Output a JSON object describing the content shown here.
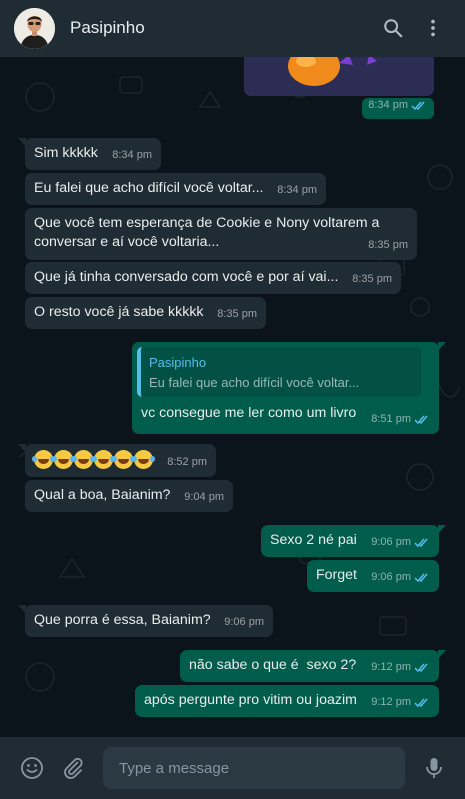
{
  "header": {
    "contact_name": "Pasipinho"
  },
  "messages": [
    {
      "direction": "out",
      "type": "sticker",
      "time": "8:34 pm",
      "status": "read"
    },
    {
      "direction": "in",
      "text": "Sim kkkkk",
      "time": "8:34 pm"
    },
    {
      "direction": "in",
      "text": "Eu falei que acho difícil você voltar...",
      "time": "8:34 pm"
    },
    {
      "direction": "in",
      "text": "Que você tem esperança de Cookie e Nony voltarem a conversar e aí você voltaria...",
      "time": "8:35 pm"
    },
    {
      "direction": "in",
      "text": "Que já tinha conversado com você e por aí vai...",
      "time": "8:35 pm"
    },
    {
      "direction": "in",
      "text": "O resto você já sabe kkkkk",
      "time": "8:35 pm"
    },
    {
      "direction": "out",
      "quote_author": "Pasipinho",
      "quote_text": "Eu falei que acho difícil você voltar...",
      "text": "vc consegue me ler como um livro",
      "time": "8:51 pm",
      "status": "read"
    },
    {
      "direction": "in",
      "text": "🤣🤣🤣🤣🤣🤣",
      "time": "8:52 pm",
      "emoji_count": 6
    },
    {
      "direction": "in",
      "text": "Qual a boa, Baianim?",
      "time": "9:04 pm"
    },
    {
      "direction": "out",
      "text": "Sexo 2 né pai",
      "time": "9:06 pm",
      "status": "read"
    },
    {
      "direction": "out",
      "text": "Forget",
      "time": "9:06 pm",
      "status": "read"
    },
    {
      "direction": "in",
      "text": "Que porra é essa, Baianim?",
      "time": "9:06 pm"
    },
    {
      "direction": "out",
      "text": "não sabe o que é  sexo 2?",
      "time": "9:12 pm",
      "status": "read"
    },
    {
      "direction": "out",
      "text": "após pergunte pro vitim ou joazim",
      "time": "9:12 pm",
      "status": "read"
    }
  ],
  "composer": {
    "placeholder": "Type a message"
  },
  "colors": {
    "header_bg": "#202c33",
    "chat_bg": "#0b141a",
    "incoming_bubble": "#202c33",
    "outgoing_bubble": "#005c4b",
    "read_tick": "#53bdeb",
    "quote_accent": "#53bdeb"
  },
  "icons": [
    "search-icon",
    "menu-icon",
    "emoji-icon",
    "attach-icon",
    "mic-icon",
    "double-check-icon"
  ]
}
